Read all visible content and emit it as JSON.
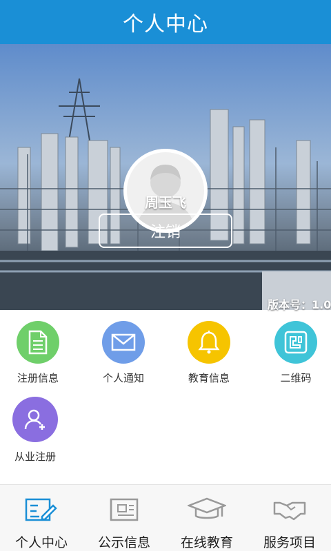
{
  "header": {
    "title": "个人中心"
  },
  "profile": {
    "username": "周玉飞",
    "logout_label": "注销",
    "version_text": "版本号：1.0."
  },
  "menu": [
    {
      "label": "注册信息",
      "icon": "document-icon",
      "color": "#6fcf6a"
    },
    {
      "label": "个人通知",
      "icon": "mail-icon",
      "color": "#6f9de8"
    },
    {
      "label": "教育信息",
      "icon": "bell-icon",
      "color": "#f6c400"
    },
    {
      "label": "二维码",
      "icon": "qrcode-icon",
      "color": "#3fc4d8"
    },
    {
      "label": "从业注册",
      "icon": "add-user-icon",
      "color": "#8a6ee0"
    }
  ],
  "tabs": [
    {
      "label": "个人中心",
      "icon": "profile-edit-icon",
      "active": true
    },
    {
      "label": "公示信息",
      "icon": "newspaper-icon",
      "active": false
    },
    {
      "label": "在线教育",
      "icon": "graduation-cap-icon",
      "active": false
    },
    {
      "label": "服务项目",
      "icon": "handshake-icon",
      "active": false
    }
  ],
  "colors": {
    "header": "#1a8fd6",
    "active_tab_icon": "#1a8fd6",
    "inactive_tab_icon": "#999999"
  }
}
